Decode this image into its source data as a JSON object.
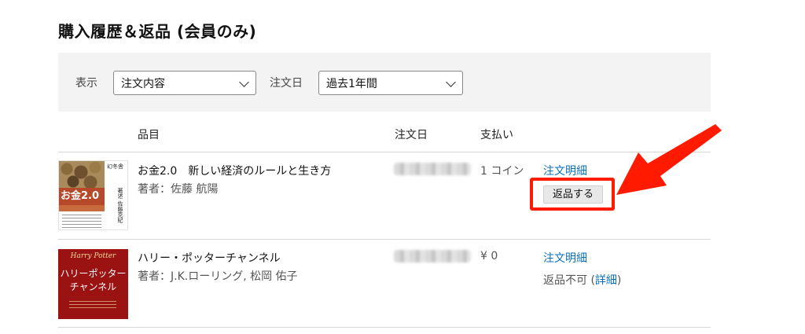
{
  "page": {
    "title": "購入履歴＆返品 (会員のみ)"
  },
  "filters": {
    "display_label": "表示",
    "display_value": "注文内容",
    "date_label": "注文日",
    "date_value": "過去1年間"
  },
  "table": {
    "headers": {
      "item": "品目",
      "order_date": "注文日",
      "payment": "支払い"
    },
    "rows": [
      {
        "title": "お金2.0　新しい経済のルールと生き方",
        "author": "著者：佐藤 航陽",
        "payment": "1 コイン",
        "detail_link": "注文明細",
        "return_button": "返品する",
        "cover": {
          "title": "お金2.0",
          "spine": "著述 佐藤克紀",
          "publisher": "幻冬舎"
        }
      },
      {
        "title": "ハリー・ポッターチャンネル",
        "author": "著者：J.K.ローリング, 松岡 佑子",
        "payment": "¥ 0",
        "detail_link": "注文明細",
        "return_status": "返品不可 (",
        "return_detail_link": "詳細",
        "return_status_close": ")",
        "cover": {
          "brand": "Harry Potter",
          "title_line1": "ハリーポッター",
          "title_line2": "チャンネル"
        }
      }
    ]
  },
  "annotation": {
    "color": "#ff1a00"
  }
}
